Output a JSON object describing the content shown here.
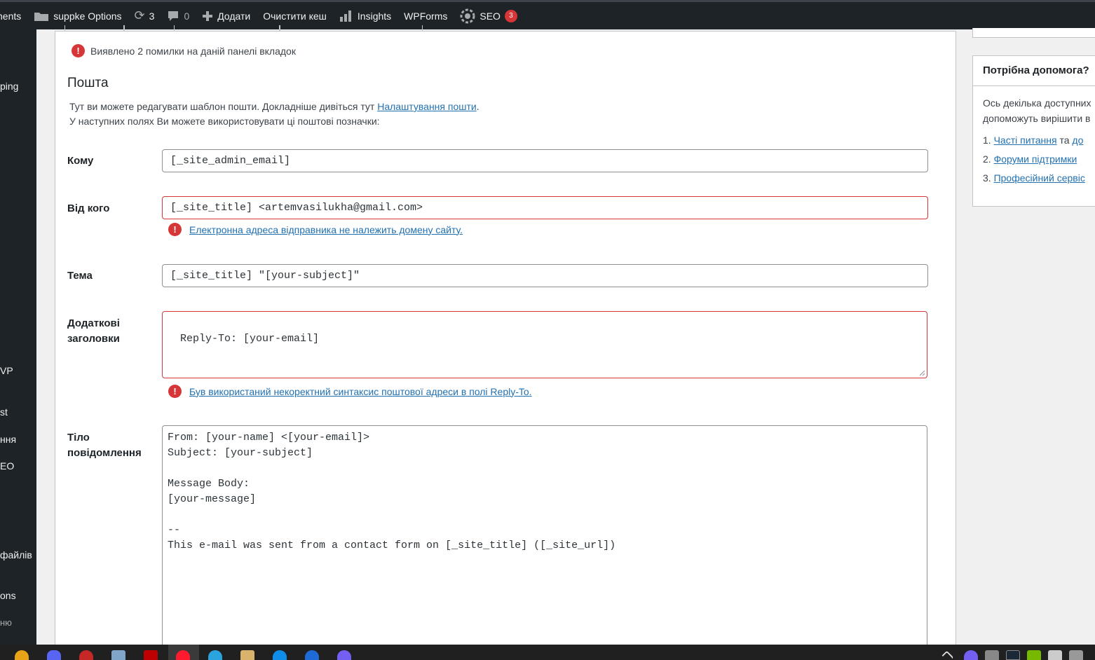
{
  "adminbar": {
    "comments_label": "nents",
    "site_options_label": "suppke Options",
    "updates_count": "3",
    "comments_count": "0",
    "add_label": "Додати",
    "clear_cache_label": "Очистити кеш",
    "insights_label": "Insights",
    "wpforms_label": "WPForms",
    "seo_label": "SEO",
    "seo_badge": "3"
  },
  "sidebar_menu": [
    {
      "label": "ping"
    },
    {
      "label": "VP"
    },
    {
      "label": "st"
    },
    {
      "label": "ння"
    },
    {
      "label": "EO"
    },
    {
      "label": "файлів"
    },
    {
      "label": "ons"
    },
    {
      "label": "ню"
    }
  ],
  "tab_errors": "Виявлено 2 помилки на даній панелі вкладок",
  "mail": {
    "heading": "Пошта",
    "desc_line1_prefix": "Тут ви можете редагувати шаблон пошти. Докладніше дивіться тут ",
    "desc_link": "Налаштування пошти",
    "desc_line1_suffix": ".",
    "desc_line2": "У наступних полях Ви можете використовувати ці поштові позначки:"
  },
  "fields": {
    "to": {
      "label": "Кому",
      "value": "[_site_admin_email]"
    },
    "from": {
      "label": "Від кого",
      "value": "[_site_title] <artemvasilukha@gmail.com>",
      "error": "Електронна адреса відправника не належить домену сайту."
    },
    "subject": {
      "label": "Тема",
      "value": "[_site_title] \"[your-subject]\""
    },
    "headers": {
      "label_line1": "Додаткові",
      "label_line2": "заголовки",
      "value": "Reply-To: [your-email]",
      "error": "Був використаний некоректний синтаксис поштової адреси в полі Reply-To."
    },
    "body": {
      "label_line1": "Тіло",
      "label_line2": "повідомлення",
      "value": "From: [your-name] <[your-email]>\nSubject: [your-subject]\n\nMessage Body:\n[your-message]\n\n-- \nThis e-mail was sent from a contact form on [_site_title] ([_site_url])"
    }
  },
  "help": {
    "title": "Потрібна допомога?",
    "text_line1": "Ось декілька доступних",
    "text_line2": "допоможуть вирішити в",
    "items": [
      {
        "num": "1.",
        "link": "Часті питання",
        "suffix": " та ",
        "link2": "до"
      },
      {
        "num": "2.",
        "link": "Форуми підтримки"
      },
      {
        "num": "3.",
        "link": "Професійний сервіс"
      }
    ]
  },
  "taskbar_icons": [
    "chrome-icon",
    "discord-icon",
    "app-icon",
    "notepad-icon",
    "filezilla-icon",
    "opera-icon",
    "telegram-icon",
    "media-icon",
    "teamviewer-icon",
    "ccleaner-icon",
    "viber-icon"
  ],
  "colors": {
    "error": "#d63638",
    "link": "#2271b1",
    "adminbar": "#1d2327"
  }
}
